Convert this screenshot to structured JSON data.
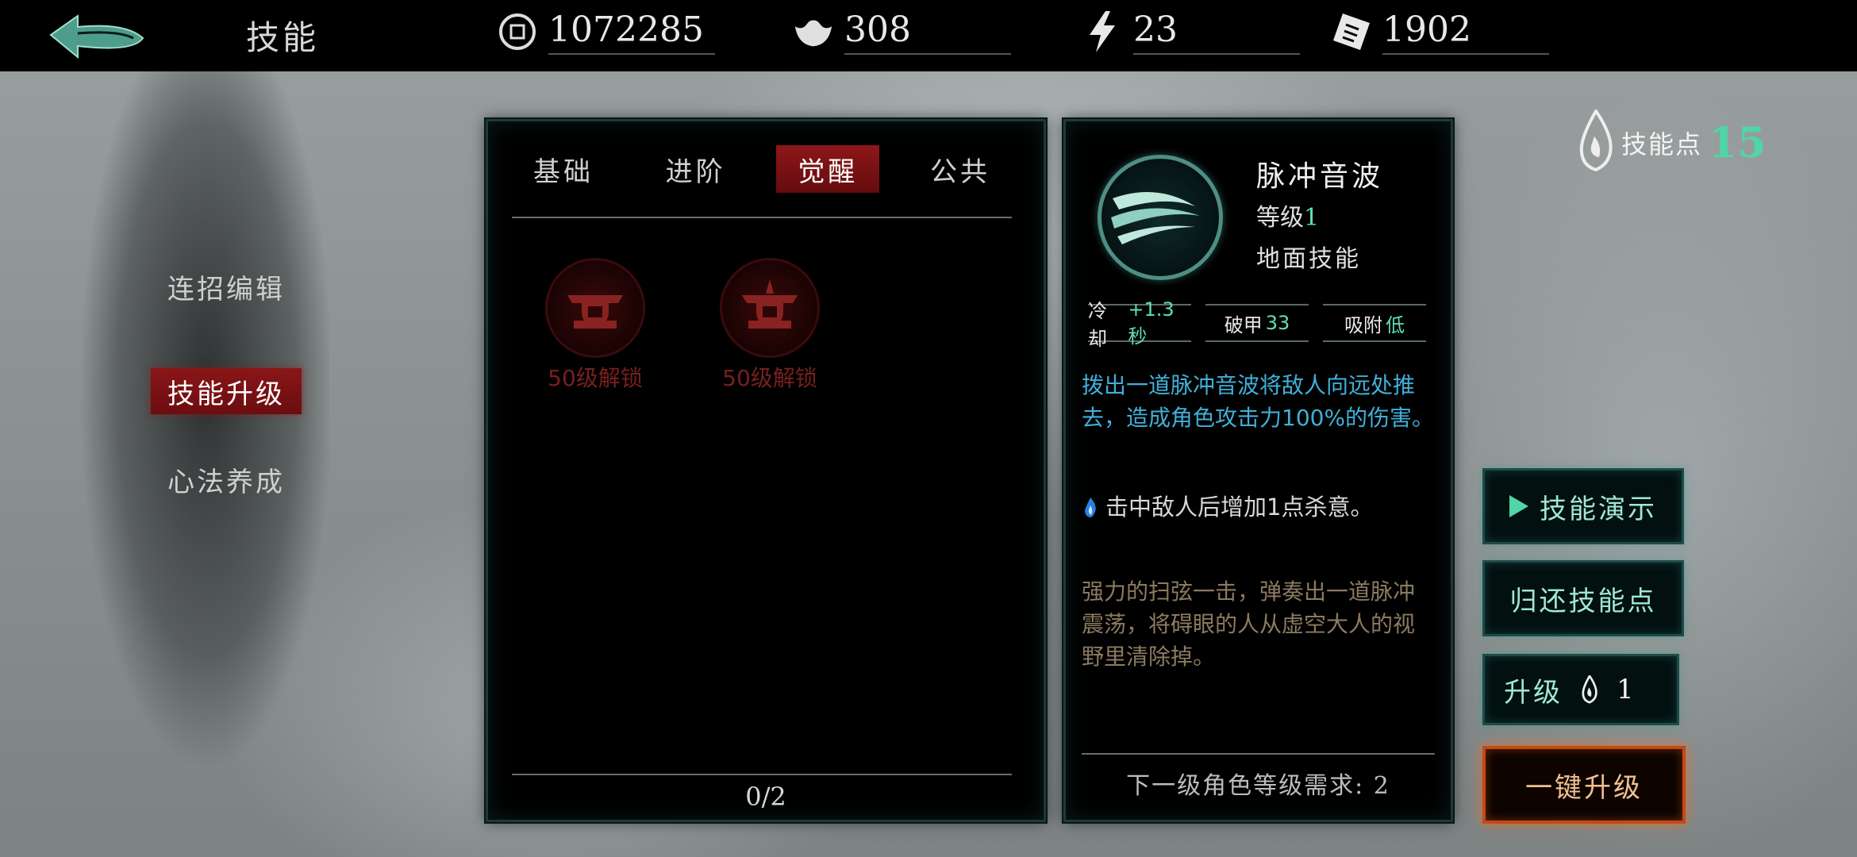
{
  "header": {
    "title": "技能",
    "resources": [
      {
        "icon": "coin-icon",
        "value": "1072285"
      },
      {
        "icon": "silver-ingot-icon",
        "value": "308"
      },
      {
        "icon": "lightning-icon",
        "value": "23"
      },
      {
        "icon": "talisman-icon",
        "value": "1902"
      }
    ]
  },
  "sidebar": {
    "items": [
      {
        "label": "连招编辑"
      },
      {
        "label": "技能升级",
        "active": true
      },
      {
        "label": "心法养成"
      }
    ]
  },
  "skill_list": {
    "tabs": [
      {
        "label": "基础"
      },
      {
        "label": "进阶"
      },
      {
        "label": "觉醒",
        "active": true
      },
      {
        "label": "公共"
      }
    ],
    "slots": [
      {
        "icon": "locked-skill-icon",
        "label": "50级解锁"
      },
      {
        "icon": "locked-skill-icon",
        "label": "50级解锁"
      }
    ],
    "count": "0/2"
  },
  "detail": {
    "name": "脉冲音波",
    "level_label": "等级",
    "level_value": "1",
    "type": "地面技能",
    "stats": [
      {
        "label": "冷却",
        "value": "+1.3秒"
      },
      {
        "label": "破甲",
        "value": "33"
      },
      {
        "label": "吸附",
        "value": "低"
      }
    ],
    "desc_main": "拨出一道脉冲音波将敌人向远处推去，造成角色攻击力100%的伤害。",
    "desc_bonus": "击中敌人后增加1点杀意。",
    "desc_flavor": "强力的扫弦一击，弹奏出一道脉冲震荡，将碍眼的人从虚空大人的视野里清除掉。",
    "requirement": "下一级角色等级需求: 2"
  },
  "skill_points": {
    "label": "技能点",
    "value": "15"
  },
  "actions": {
    "demo": "技能演示",
    "refund": "归还技能点",
    "upgrade_label": "升级",
    "upgrade_cost": "1",
    "upgrade_all": "一键升级"
  },
  "colors": {
    "accent_red": "#8e1719",
    "accent_teal": "#4fd6a8",
    "desc_blue": "#3fb0d8",
    "upgrade_orange": "#c44a12"
  }
}
